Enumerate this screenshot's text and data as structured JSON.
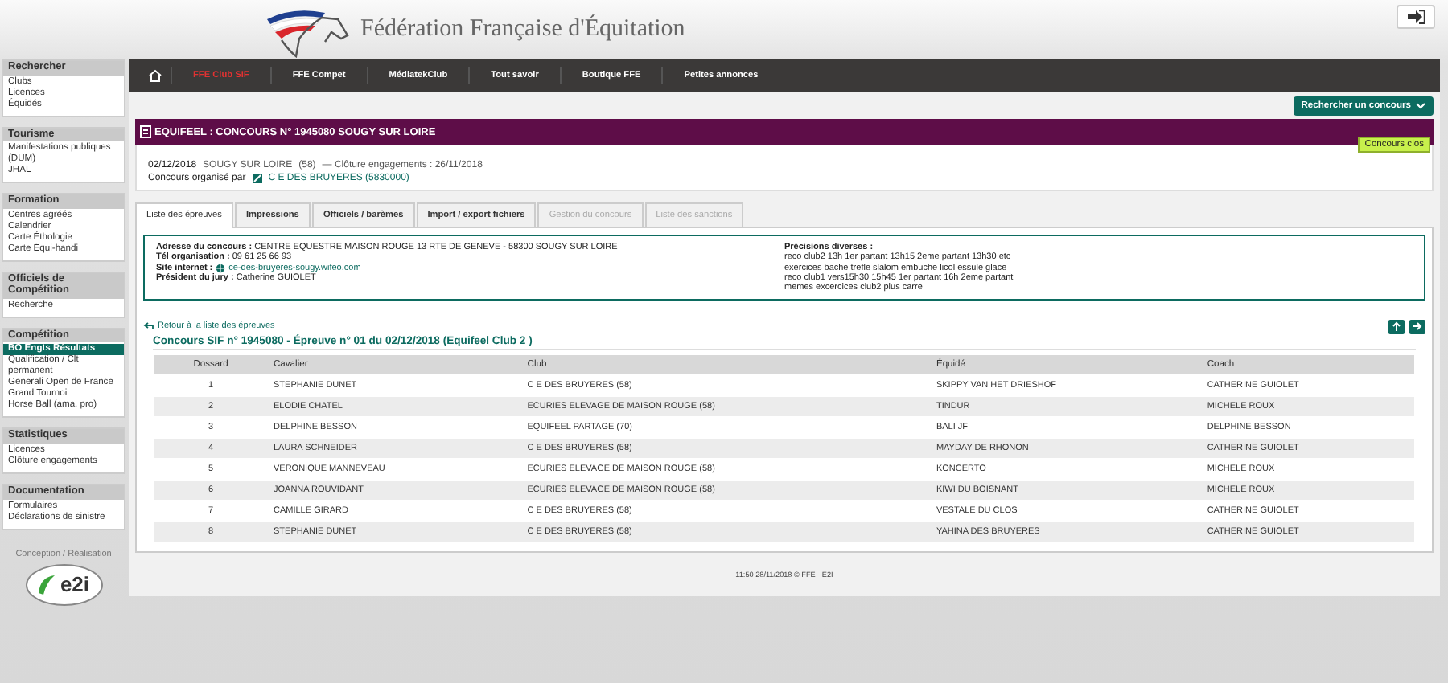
{
  "header": {
    "brand": "Fédération Française d'Équitation"
  },
  "sidebar": [
    {
      "title": "Rechercher",
      "items": [
        {
          "label": "Clubs",
          "selected": false
        },
        {
          "label": "Licences",
          "selected": false
        },
        {
          "label": "Équidés",
          "selected": false
        }
      ]
    },
    {
      "title": "Tourisme",
      "items": [
        {
          "label": "Manifestations publiques (DUM)",
          "selected": false
        },
        {
          "label": "JHAL",
          "selected": false
        }
      ]
    },
    {
      "title": "Formation",
      "items": [
        {
          "label": "Centres agréés",
          "selected": false
        },
        {
          "label": "Calendrier",
          "selected": false
        },
        {
          "label": "Carte Éthologie",
          "selected": false
        },
        {
          "label": "Carte Équi-handi",
          "selected": false
        }
      ]
    },
    {
      "title": "Officiels de Compétition",
      "items": [
        {
          "label": "Recherche",
          "selected": false
        }
      ]
    },
    {
      "title": "Compétition",
      "items": [
        {
          "label": "BO Engts Résultats",
          "selected": true
        },
        {
          "label": "Qualification / Clt permanent",
          "selected": false
        },
        {
          "label": "Generali Open de France",
          "selected": false
        },
        {
          "label": "Grand Tournoi",
          "selected": false
        },
        {
          "label": "Horse Ball (ama, pro)",
          "selected": false
        }
      ]
    },
    {
      "title": "Statistiques",
      "items": [
        {
          "label": "Licences",
          "selected": false
        },
        {
          "label": "Clôture engagements",
          "selected": false
        }
      ]
    },
    {
      "title": "Documentation",
      "items": [
        {
          "label": "Formulaires",
          "selected": false
        },
        {
          "label": "Déclarations de sinistre",
          "selected": false
        }
      ]
    }
  ],
  "credit": {
    "label": "Conception / Réalisation",
    "logo": "e2i"
  },
  "nav": [
    {
      "label": "FFE Club SIF",
      "selected": true
    },
    {
      "label": "FFE Compet",
      "selected": false
    },
    {
      "label": "MédiatekClub",
      "selected": false
    },
    {
      "label": "Tout savoir",
      "selected": false
    },
    {
      "label": "Boutique FFE",
      "selected": false
    },
    {
      "label": "Petites annonces",
      "selected": false
    }
  ],
  "search_button": "Rechercher un concours",
  "competition": {
    "title": "EQUIFEEL : CONCOURS N° 1945080 SOUGY SUR LOIRE",
    "status": "Concours clos",
    "date": "02/12/2018",
    "place": "SOUGY SUR LOIRE",
    "dept": "(58)",
    "closing": "— Clôture engagements : 26/11/2018",
    "organizer_label": "Concours organisé par",
    "organizer": "C E DES BRUYERES (5830000)"
  },
  "tabs": [
    {
      "label": "Liste des épreuves",
      "selected": true,
      "disabled": false
    },
    {
      "label": "Impressions",
      "selected": false,
      "disabled": false
    },
    {
      "label": "Officiels / barèmes",
      "selected": false,
      "disabled": false
    },
    {
      "label": "Import / export fichiers",
      "selected": false,
      "disabled": false
    },
    {
      "label": "Gestion du concours",
      "selected": false,
      "disabled": true
    },
    {
      "label": "Liste des sanctions",
      "selected": false,
      "disabled": true
    }
  ],
  "details": {
    "address_label": "Adresse du concours :",
    "address": "CENTRE EQUESTRE MAISON ROUGE 13 RTE DE GENEVE - 58300 SOUGY SUR LOIRE",
    "phone_label": "Tél organisation :",
    "phone": "09 61 25 66 93",
    "site_label": "Site internet :",
    "site": "ce-des-bruyeres-sougy.wifeo.com",
    "jury_label": "Président du jury :",
    "jury": "Catherine GUIOLET",
    "notes_label": "Précisions diverses :",
    "notes": [
      "reco club2 13h 1er partant 13h15 2eme partant 13h30 etc",
      "exercices bache trefle slalom embuche licol essule glace",
      "reco club1 vers15h30 15h45 1er partant 16h 2eme partant",
      "memes excercices club2 plus carre"
    ]
  },
  "back_link": "Retour à la liste des épreuves",
  "event_title": "Concours SIF n° 1945080 - Épreuve n° 01 du 02/12/2018 (Equifeel Club 2 )",
  "table": {
    "columns": [
      "Dossard",
      "Cavalier",
      "Club",
      "Équidé",
      "Coach"
    ],
    "rows": [
      [
        "1",
        "STEPHANIE DUNET",
        "C E DES BRUYERES (58)",
        "SKIPPY VAN HET DRIESHOF",
        "CATHERINE GUIOLET"
      ],
      [
        "2",
        "ELODIE CHATEL",
        "ECURIES ELEVAGE DE MAISON ROUGE (58)",
        "TINDUR",
        "MICHELE ROUX"
      ],
      [
        "3",
        "DELPHINE BESSON",
        "EQUIFEEL PARTAGE (70)",
        "BALI JF",
        "DELPHINE BESSON"
      ],
      [
        "4",
        "LAURA SCHNEIDER",
        "C E DES BRUYERES (58)",
        "MAYDAY DE RHONON",
        "CATHERINE GUIOLET"
      ],
      [
        "5",
        "VERONIQUE MANNEVEAU",
        "ECURIES ELEVAGE DE MAISON ROUGE (58)",
        "KONCERTO",
        "MICHELE ROUX"
      ],
      [
        "6",
        "JOANNA ROUVIDANT",
        "ECURIES ELEVAGE DE MAISON ROUGE (58)",
        "KIWI DU BOISNANT",
        "MICHELE ROUX"
      ],
      [
        "7",
        "CAMILLE GIRARD",
        "C E DES BRUYERES (58)",
        "VESTALE DU CLOS",
        "CATHERINE GUIOLET"
      ],
      [
        "8",
        "STEPHANIE DUNET",
        "C E DES BRUYERES (58)",
        "YAHINA DES BRUYERES",
        "CATHERINE GUIOLET"
      ]
    ]
  },
  "footer": "11:50 28/11/2018 © FFE - E2I"
}
